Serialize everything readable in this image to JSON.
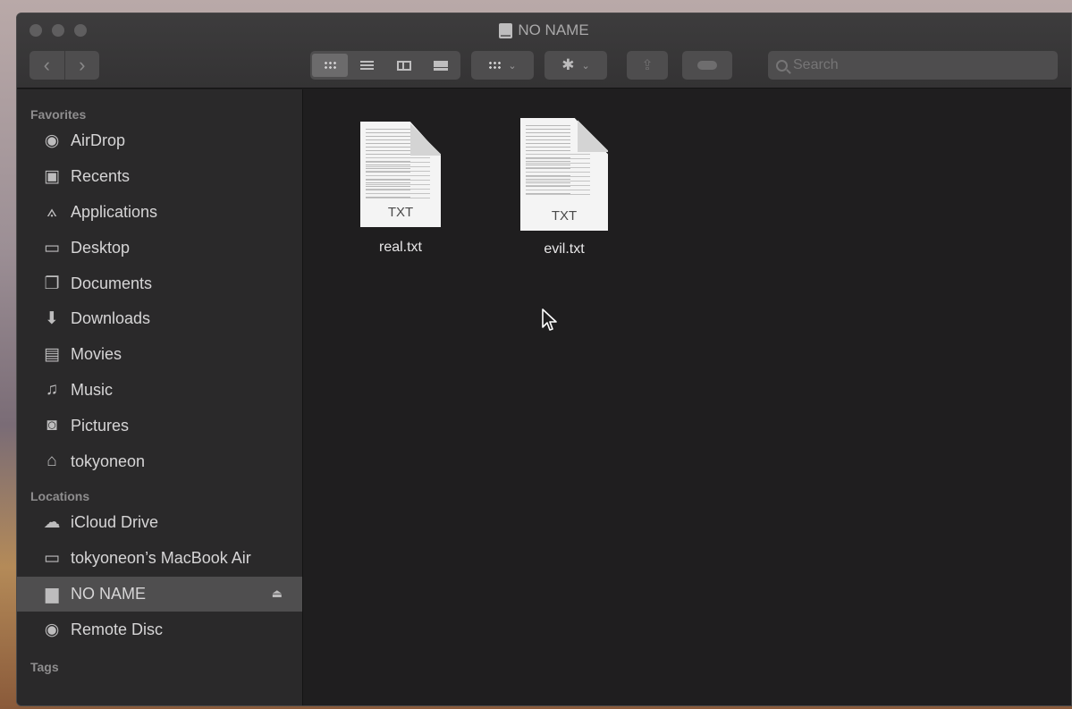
{
  "window": {
    "title": "NO NAME",
    "title_icon": "external-disk-icon"
  },
  "toolbar": {
    "back_icon": "chevron-left-icon",
    "forward_icon": "chevron-right-icon",
    "view_modes": [
      "icon-view-icon",
      "list-view-icon",
      "column-view-icon",
      "gallery-view-icon"
    ],
    "active_view": "icon",
    "group_icon": "group-grid-icon",
    "action_icon": "gear-icon",
    "share_icon": "share-icon",
    "tag_icon": "tag-icon",
    "search_placeholder": "Search"
  },
  "sidebar": {
    "favorites_heading": "Favorites",
    "favorites": [
      {
        "label": "AirDrop",
        "icon": "airdrop-icon"
      },
      {
        "label": "Recents",
        "icon": "recents-icon"
      },
      {
        "label": "Applications",
        "icon": "applications-icon"
      },
      {
        "label": "Desktop",
        "icon": "desktop-icon"
      },
      {
        "label": "Documents",
        "icon": "documents-icon"
      },
      {
        "label": "Downloads",
        "icon": "downloads-icon"
      },
      {
        "label": "Movies",
        "icon": "movies-icon"
      },
      {
        "label": "Music",
        "icon": "music-icon"
      },
      {
        "label": "Pictures",
        "icon": "pictures-icon"
      },
      {
        "label": "tokyoneon",
        "icon": "home-icon"
      }
    ],
    "locations_heading": "Locations",
    "locations": [
      {
        "label": "iCloud Drive",
        "icon": "cloud-icon"
      },
      {
        "label": "tokyoneon’s MacBook Air",
        "icon": "laptop-icon"
      },
      {
        "label": "NO NAME",
        "icon": "external-disk-icon",
        "selected": true
      },
      {
        "label": "Remote Disc",
        "icon": "disc-icon"
      }
    ],
    "tags_heading": "Tags"
  },
  "files": [
    {
      "name": "real.txt",
      "ext": "TXT"
    },
    {
      "name": "evil.txt",
      "ext": "TXT"
    }
  ],
  "colors": {
    "window_bg": "#1f1e1f",
    "sidebar_bg": "#2a292a",
    "selected_bg": "#4f4e4f"
  }
}
